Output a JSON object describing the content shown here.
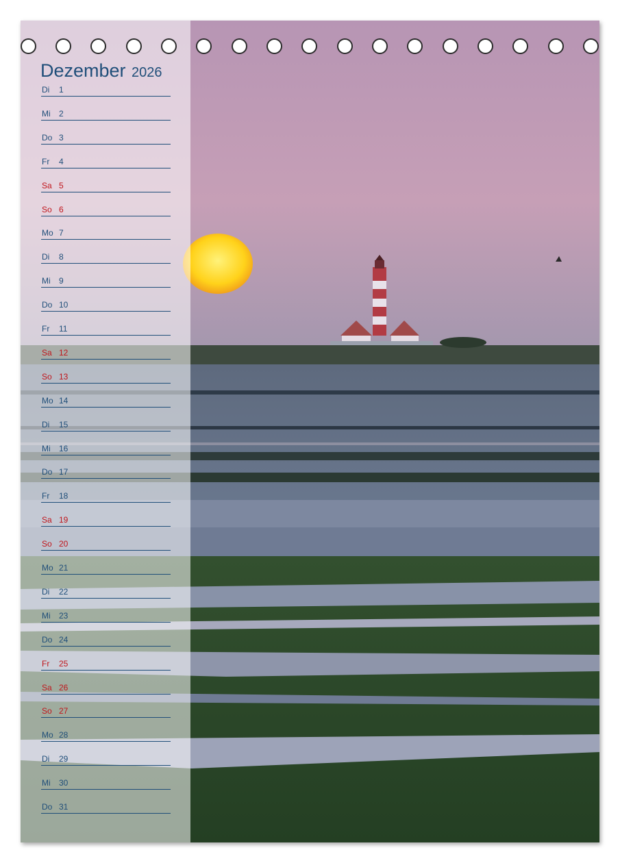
{
  "calendar": {
    "month": "Dezember",
    "year": "2026",
    "days": [
      {
        "weekday": "Di",
        "day": "1",
        "highlight": false
      },
      {
        "weekday": "Mi",
        "day": "2",
        "highlight": false
      },
      {
        "weekday": "Do",
        "day": "3",
        "highlight": false
      },
      {
        "weekday": "Fr",
        "day": "4",
        "highlight": false
      },
      {
        "weekday": "Sa",
        "day": "5",
        "highlight": true
      },
      {
        "weekday": "So",
        "day": "6",
        "highlight": true
      },
      {
        "weekday": "Mo",
        "day": "7",
        "highlight": false
      },
      {
        "weekday": "Di",
        "day": "8",
        "highlight": false
      },
      {
        "weekday": "Mi",
        "day": "9",
        "highlight": false
      },
      {
        "weekday": "Do",
        "day": "10",
        "highlight": false
      },
      {
        "weekday": "Fr",
        "day": "11",
        "highlight": false
      },
      {
        "weekday": "Sa",
        "day": "12",
        "highlight": true
      },
      {
        "weekday": "So",
        "day": "13",
        "highlight": true
      },
      {
        "weekday": "Mo",
        "day": "14",
        "highlight": false
      },
      {
        "weekday": "Di",
        "day": "15",
        "highlight": false
      },
      {
        "weekday": "Mi",
        "day": "16",
        "highlight": false
      },
      {
        "weekday": "Do",
        "day": "17",
        "highlight": false
      },
      {
        "weekday": "Fr",
        "day": "18",
        "highlight": false
      },
      {
        "weekday": "Sa",
        "day": "19",
        "highlight": true
      },
      {
        "weekday": "So",
        "day": "20",
        "highlight": true
      },
      {
        "weekday": "Mo",
        "day": "21",
        "highlight": false
      },
      {
        "weekday": "Di",
        "day": "22",
        "highlight": false
      },
      {
        "weekday": "Mi",
        "day": "23",
        "highlight": false
      },
      {
        "weekday": "Do",
        "day": "24",
        "highlight": false
      },
      {
        "weekday": "Fr",
        "day": "25",
        "highlight": true
      },
      {
        "weekday": "Sa",
        "day": "26",
        "highlight": true
      },
      {
        "weekday": "So",
        "day": "27",
        "highlight": true
      },
      {
        "weekday": "Mo",
        "day": "28",
        "highlight": false
      },
      {
        "weekday": "Di",
        "day": "29",
        "highlight": false
      },
      {
        "weekday": "Mi",
        "day": "30",
        "highlight": false
      },
      {
        "weekday": "Do",
        "day": "31",
        "highlight": false
      }
    ]
  },
  "colors": {
    "text": "#1f4e79",
    "highlight": "#c0151b",
    "sky_top": "#c09ab8",
    "sky_bottom": "#9e8fa8",
    "sun": "#ffdd22",
    "marsh": "#2f4a2c"
  },
  "photo": {
    "subject": "lighthouse-at-sunset"
  }
}
